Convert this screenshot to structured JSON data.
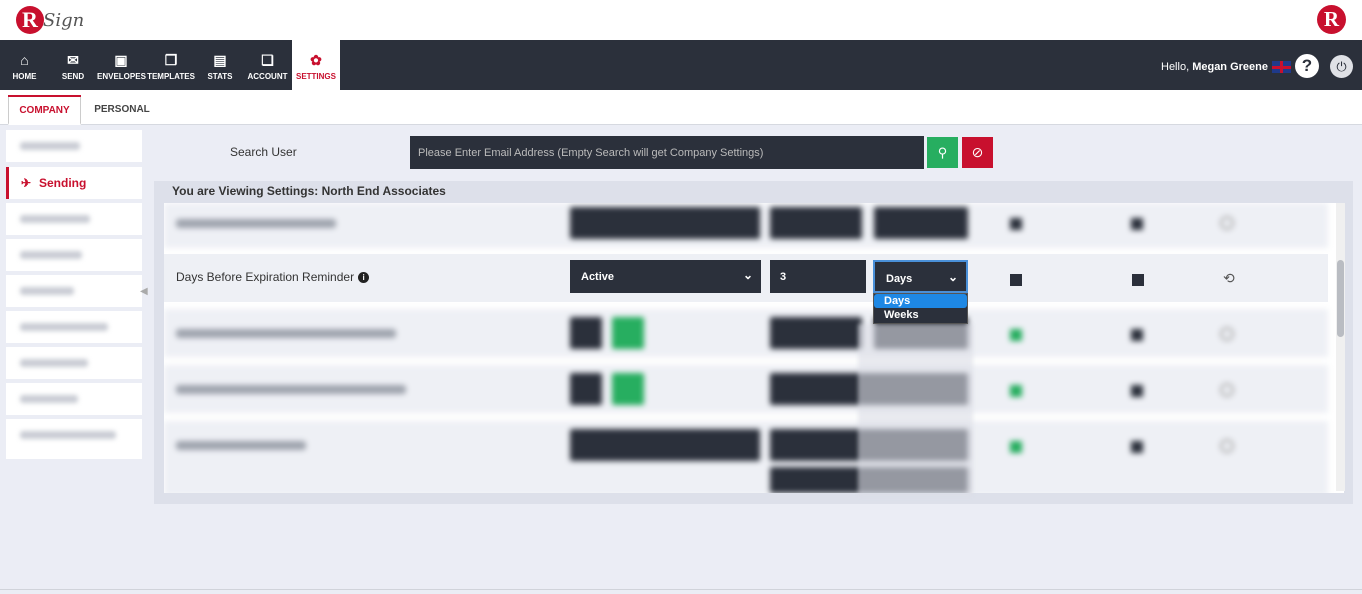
{
  "app": {
    "logo_letter": "R",
    "logo_text": "Sign",
    "brand_letter": "R"
  },
  "nav": {
    "items": [
      {
        "label": "HOME",
        "icon": "home-icon",
        "glyph": "⌂"
      },
      {
        "label": "SEND",
        "icon": "envelope-icon",
        "glyph": "✉"
      },
      {
        "label": "ENVELOPES",
        "icon": "inbox-icon",
        "glyph": "▣"
      },
      {
        "label": "TEMPLATES",
        "icon": "templates-icon",
        "glyph": "❐"
      },
      {
        "label": "STATS",
        "icon": "briefcase-icon",
        "glyph": "▤"
      },
      {
        "label": "ACCOUNT",
        "icon": "account-icon",
        "glyph": "❏"
      },
      {
        "label": "SETTINGS",
        "icon": "gear-icon",
        "glyph": "✿"
      }
    ],
    "greeting": "Hello, ",
    "user_name": "Megan Greene",
    "help_glyph": "?",
    "power_glyph": "⏻"
  },
  "subtabs": {
    "company": "COMPANY",
    "personal": "PERSONAL"
  },
  "sidebar": {
    "active_label": "Sending",
    "active_icon": "paper-plane-icon",
    "active_glyph": "✈",
    "collapse_glyph": "◀"
  },
  "search": {
    "label": "Search User",
    "placeholder": "Please Enter Email Address (Empty Search will get Company Settings)",
    "search_glyph": "⚲",
    "clear_glyph": "⊘"
  },
  "panel": {
    "title": "You are Viewing Settings: North End Associates",
    "row": {
      "label": "Days Before Expiration Reminder",
      "info_glyph": "i",
      "status_value": "Active",
      "number_value": "3",
      "unit_value": "Days",
      "chevron": "⌄",
      "history_glyph": "⟲"
    },
    "dropdown_options": [
      "Days",
      "Weeks"
    ]
  },
  "colors": {
    "nav_bg": "#2b303b",
    "brand_red": "#c8102e",
    "green": "#27ae60",
    "highlight": "#1e88e5"
  }
}
